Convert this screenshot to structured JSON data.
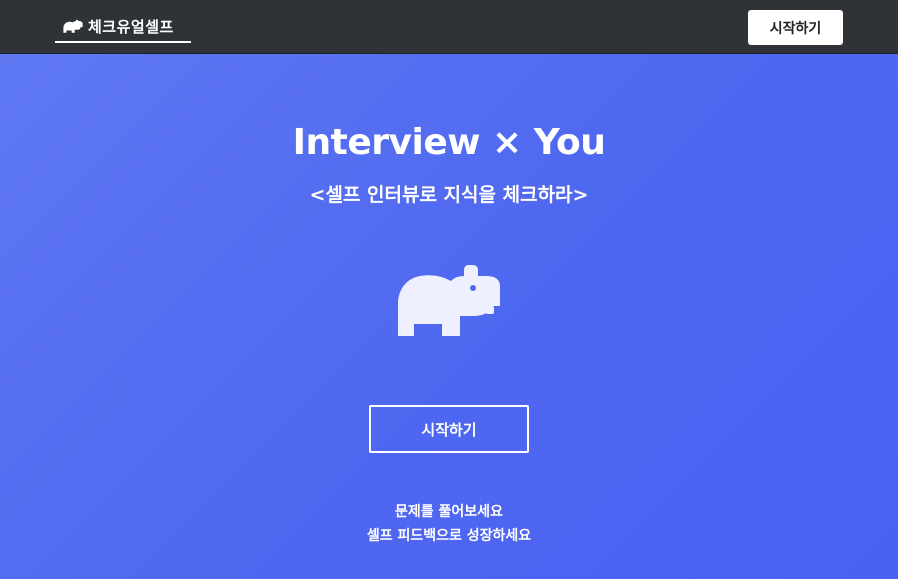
{
  "navbar": {
    "brand_label": "체크유얼셀프",
    "brand_icon": "hippo-icon",
    "start_button_label": "시작하기"
  },
  "hero": {
    "title": "Interview × You",
    "subtitle": "<셀프 인터뷰로 지식을 체크하라>",
    "mascot_icon": "hippo-icon",
    "start_button_label": "시작하기",
    "tagline_line1": "문제를 풀어보세요",
    "tagline_line2": "셀프 피드백으로 성장하세요"
  },
  "colors": {
    "navbar_bg": "#2f3338",
    "hero_gradient_start": "#5f78f2",
    "hero_gradient_end": "#4a60f2",
    "mascot_fill": "#eef0ff"
  }
}
